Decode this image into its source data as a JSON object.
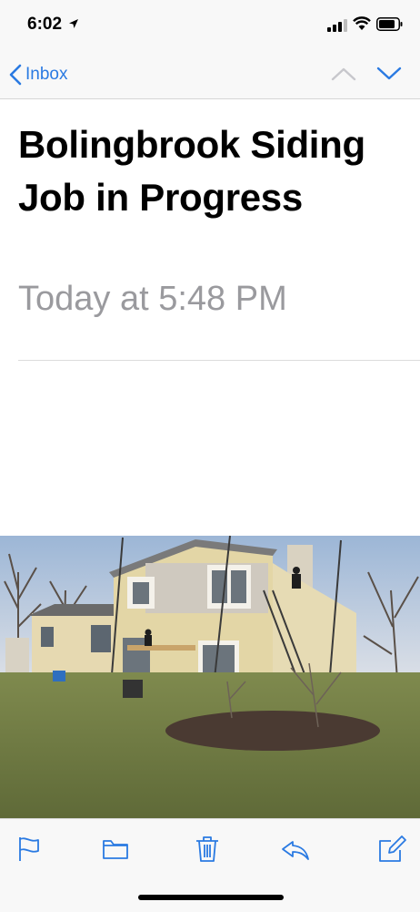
{
  "status_bar": {
    "time": "6:02"
  },
  "nav": {
    "back_label": "Inbox"
  },
  "message": {
    "subject": "Bolingbrook Siding Job in Progress",
    "date": "Today at 5:48 PM"
  },
  "colors": {
    "accent": "#2a7ae2",
    "secondary_text": "#9a9a9e",
    "bar_background": "#f8f8f8"
  },
  "toolbar": {
    "icons": [
      "flag-icon",
      "folder-icon",
      "trash-icon",
      "reply-icon",
      "compose-icon"
    ]
  }
}
